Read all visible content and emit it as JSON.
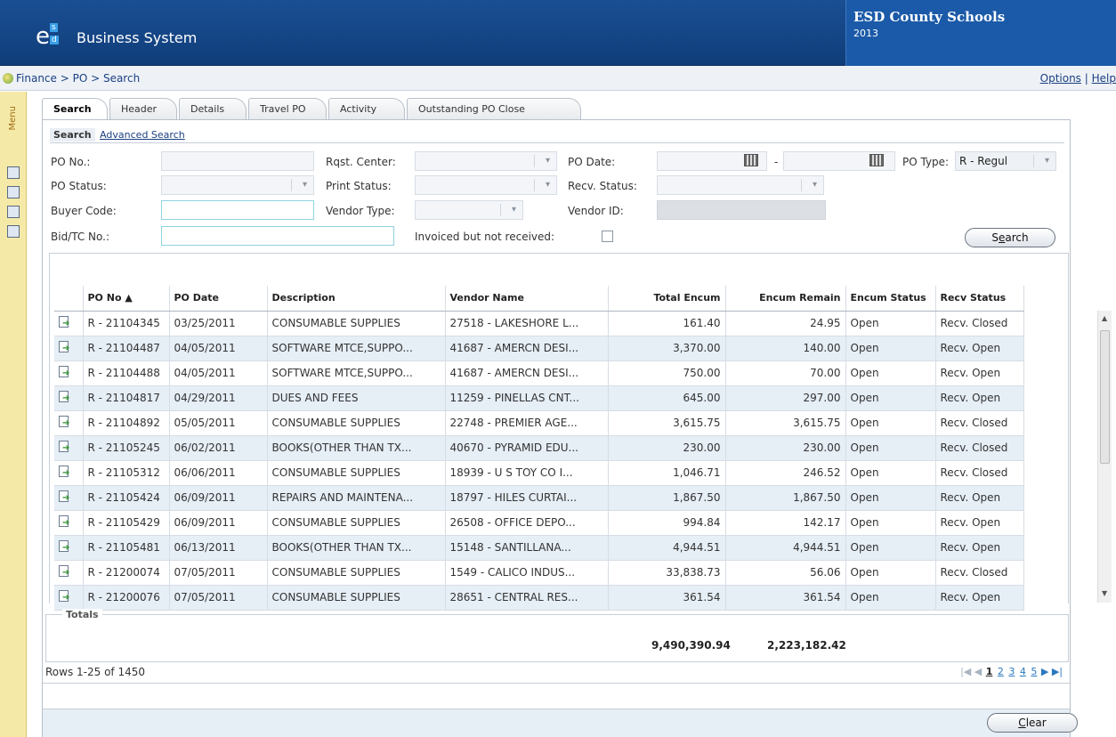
{
  "header": {
    "app_name": "Business System",
    "logo_letter": "e",
    "logo_sup": "s",
    "logo_sub": "d",
    "district_name": "ESD County Schools",
    "year": "2013"
  },
  "breadcrumb": "Finance > PO > Search",
  "top_links": {
    "options": "Options",
    "separator": "|",
    "help": "Help"
  },
  "menu_label": "Menu",
  "tabs": [
    "Search",
    "Header",
    "Details",
    "Travel PO",
    "Activity",
    "Outstanding PO Close"
  ],
  "subtabs": {
    "search": "Search",
    "advanced": "Advanced Search"
  },
  "form": {
    "po_no": "PO No.:",
    "rqst_center": "Rqst. Center:",
    "po_date": "PO Date:",
    "date_dash": "-",
    "po_type": "PO Type:",
    "po_type_value": "R - Regul",
    "po_status": "PO Status:",
    "print_status": "Print Status:",
    "recv_status": "Recv. Status:",
    "buyer_code": "Buyer Code:",
    "vendor_type": "Vendor Type:",
    "vendor_id": "Vendor ID:",
    "bid_tc": "Bid/TC No.:",
    "invoiced": "Invoiced but not received:",
    "search_btn_pre": "S",
    "search_btn_ul": "e",
    "search_btn_post": "arch"
  },
  "grid": {
    "headers": [
      "PO No ▲",
      "PO Date",
      "Description",
      "Vendor Name",
      "Total Encum",
      "Encum Remain",
      "Encum Status",
      "Recv Status"
    ],
    "rows": [
      [
        "R - 21104345",
        "03/25/2011",
        "CONSUMABLE SUPPLIES",
        "27518 - LAKESHORE L...",
        "161.40",
        "24.95",
        "Open",
        "Recv. Closed"
      ],
      [
        "R - 21104487",
        "04/05/2011",
        "SOFTWARE MTCE,SUPPO...",
        "41687 - AMERCN DESI...",
        "3,370.00",
        "140.00",
        "Open",
        "Recv. Open"
      ],
      [
        "R - 21104488",
        "04/05/2011",
        "SOFTWARE MTCE,SUPPO...",
        "41687 - AMERCN DESI...",
        "750.00",
        "70.00",
        "Open",
        "Recv. Open"
      ],
      [
        "R - 21104817",
        "04/29/2011",
        "DUES AND FEES",
        "11259 - PINELLAS CNT...",
        "645.00",
        "297.00",
        "Open",
        "Recv. Open"
      ],
      [
        "R - 21104892",
        "05/05/2011",
        "CONSUMABLE SUPPLIES",
        "22748 - PREMIER AGE...",
        "3,615.75",
        "3,615.75",
        "Open",
        "Recv. Closed"
      ],
      [
        "R - 21105245",
        "06/02/2011",
        "BOOKS(OTHER THAN TX...",
        "40670 - PYRAMID EDU...",
        "230.00",
        "230.00",
        "Open",
        "Recv. Closed"
      ],
      [
        "R - 21105312",
        "06/06/2011",
        "CONSUMABLE SUPPLIES",
        "18939 - U S TOY CO I...",
        "1,046.71",
        "246.52",
        "Open",
        "Recv. Closed"
      ],
      [
        "R - 21105424",
        "06/09/2011",
        "REPAIRS AND MAINTENA...",
        "18797 - HILES CURTAI...",
        "1,867.50",
        "1,867.50",
        "Open",
        "Recv. Open"
      ],
      [
        "R - 21105429",
        "06/09/2011",
        "CONSUMABLE SUPPLIES",
        "26508 - OFFICE DEPO...",
        "994.84",
        "142.17",
        "Open",
        "Recv. Open"
      ],
      [
        "R - 21105481",
        "06/13/2011",
        "BOOKS(OTHER THAN TX...",
        "15148 - SANTILLANA...",
        "4,944.51",
        "4,944.51",
        "Open",
        "Recv. Open"
      ],
      [
        "R - 21200074",
        "07/05/2011",
        "CONSUMABLE SUPPLIES",
        "1549 - CALICO INDUS...",
        "33,838.73",
        "56.06",
        "Open",
        "Recv. Closed"
      ],
      [
        "R - 21200076",
        "07/05/2011",
        "CONSUMABLE SUPPLIES",
        "28651 - CENTRAL RES...",
        "361.54",
        "361.54",
        "Open",
        "Recv. Open"
      ]
    ]
  },
  "totals": {
    "label": "Totals",
    "total_encum": "9,490,390.94",
    "encum_remain": "2,223,182.42"
  },
  "rows_info": "Rows 1-25 of 1450",
  "pager": {
    "pages": [
      "1",
      "2",
      "3",
      "4",
      "5"
    ],
    "current": "1"
  },
  "clear_btn_ul": "C",
  "clear_btn_post": "lear"
}
